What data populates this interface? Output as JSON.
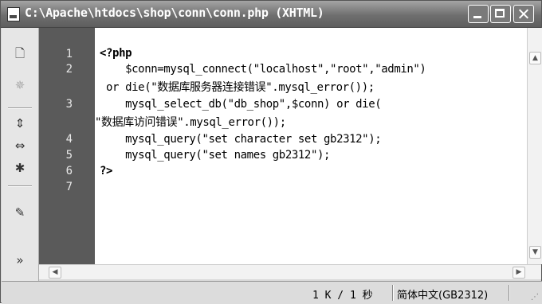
{
  "window": {
    "title": "C:\\Apache\\htdocs\\shop\\conn\\conn.php (XHTML)"
  },
  "toolbar": {
    "tools": [
      {
        "icon": "new-document-icon",
        "glyph": "🗋"
      },
      {
        "icon": "asterisk-icon",
        "glyph": "✵"
      },
      {
        "icon": "expand-icon",
        "glyph": "⇕"
      },
      {
        "icon": "collapse-icon",
        "glyph": "⇔"
      },
      {
        "icon": "select-icon",
        "glyph": "✱"
      },
      {
        "icon": "comment-icon",
        "glyph": "✎"
      },
      {
        "icon": "more-icon",
        "glyph": "»"
      }
    ]
  },
  "code": {
    "line_numbers": [
      "1",
      "2",
      "3",
      "4",
      "5",
      "6",
      "7"
    ],
    "lines": [
      "<?php",
      "    $conn=mysql_connect(\"localhost\",\"root\",\"admin\")",
      " or die(\"数据库服务器连接错误\".mysql_error());",
      "    mysql_select_db(\"db_shop\",$conn) or die(",
      "\"数据库访问错误\".mysql_error());",
      "    mysql_query(\"set character set gb2312\");",
      "    mysql_query(\"set names gb2312\");",
      "?>"
    ]
  },
  "status": {
    "size_time": "1 K / 1 秒",
    "encoding": "简体中文(GB2312)"
  },
  "colors": {
    "gutter": "#5a5a5a",
    "titlebar": "#6f6f6f"
  }
}
